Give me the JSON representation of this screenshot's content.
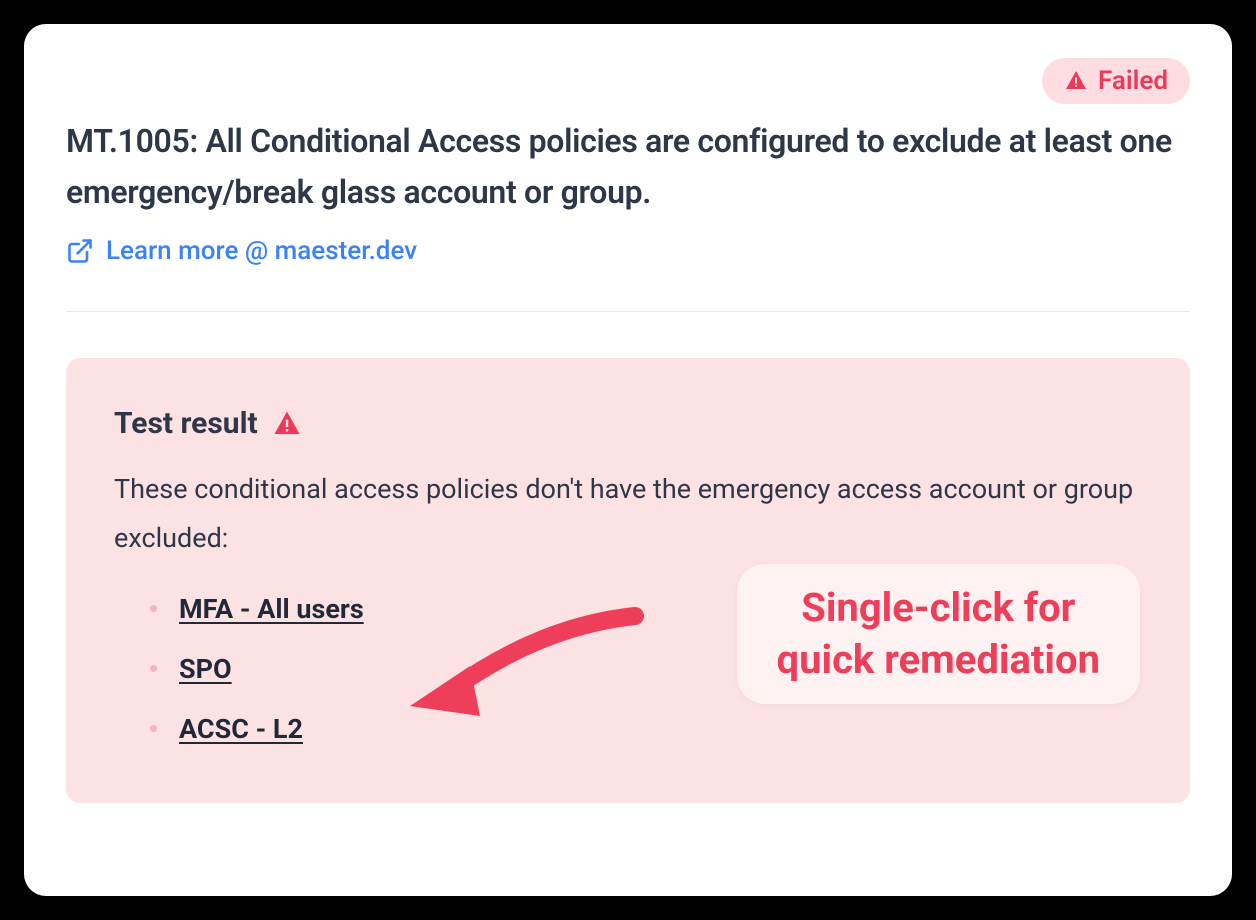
{
  "badge": {
    "label": "Failed"
  },
  "title": "MT.1005: All Conditional Access policies are configured to exclude at least one emergency/break glass account or group.",
  "learn_more": {
    "label": "Learn more @ maester.dev"
  },
  "result": {
    "heading": "Test result",
    "description": "These conditional access policies don't have the emergency access account or group excluded:",
    "policies": [
      {
        "label": "MFA - All users"
      },
      {
        "label": "SPO"
      },
      {
        "label": "ACSC - L2"
      }
    ]
  },
  "callout": {
    "line1": "Single-click for",
    "line2": "quick remediation"
  }
}
